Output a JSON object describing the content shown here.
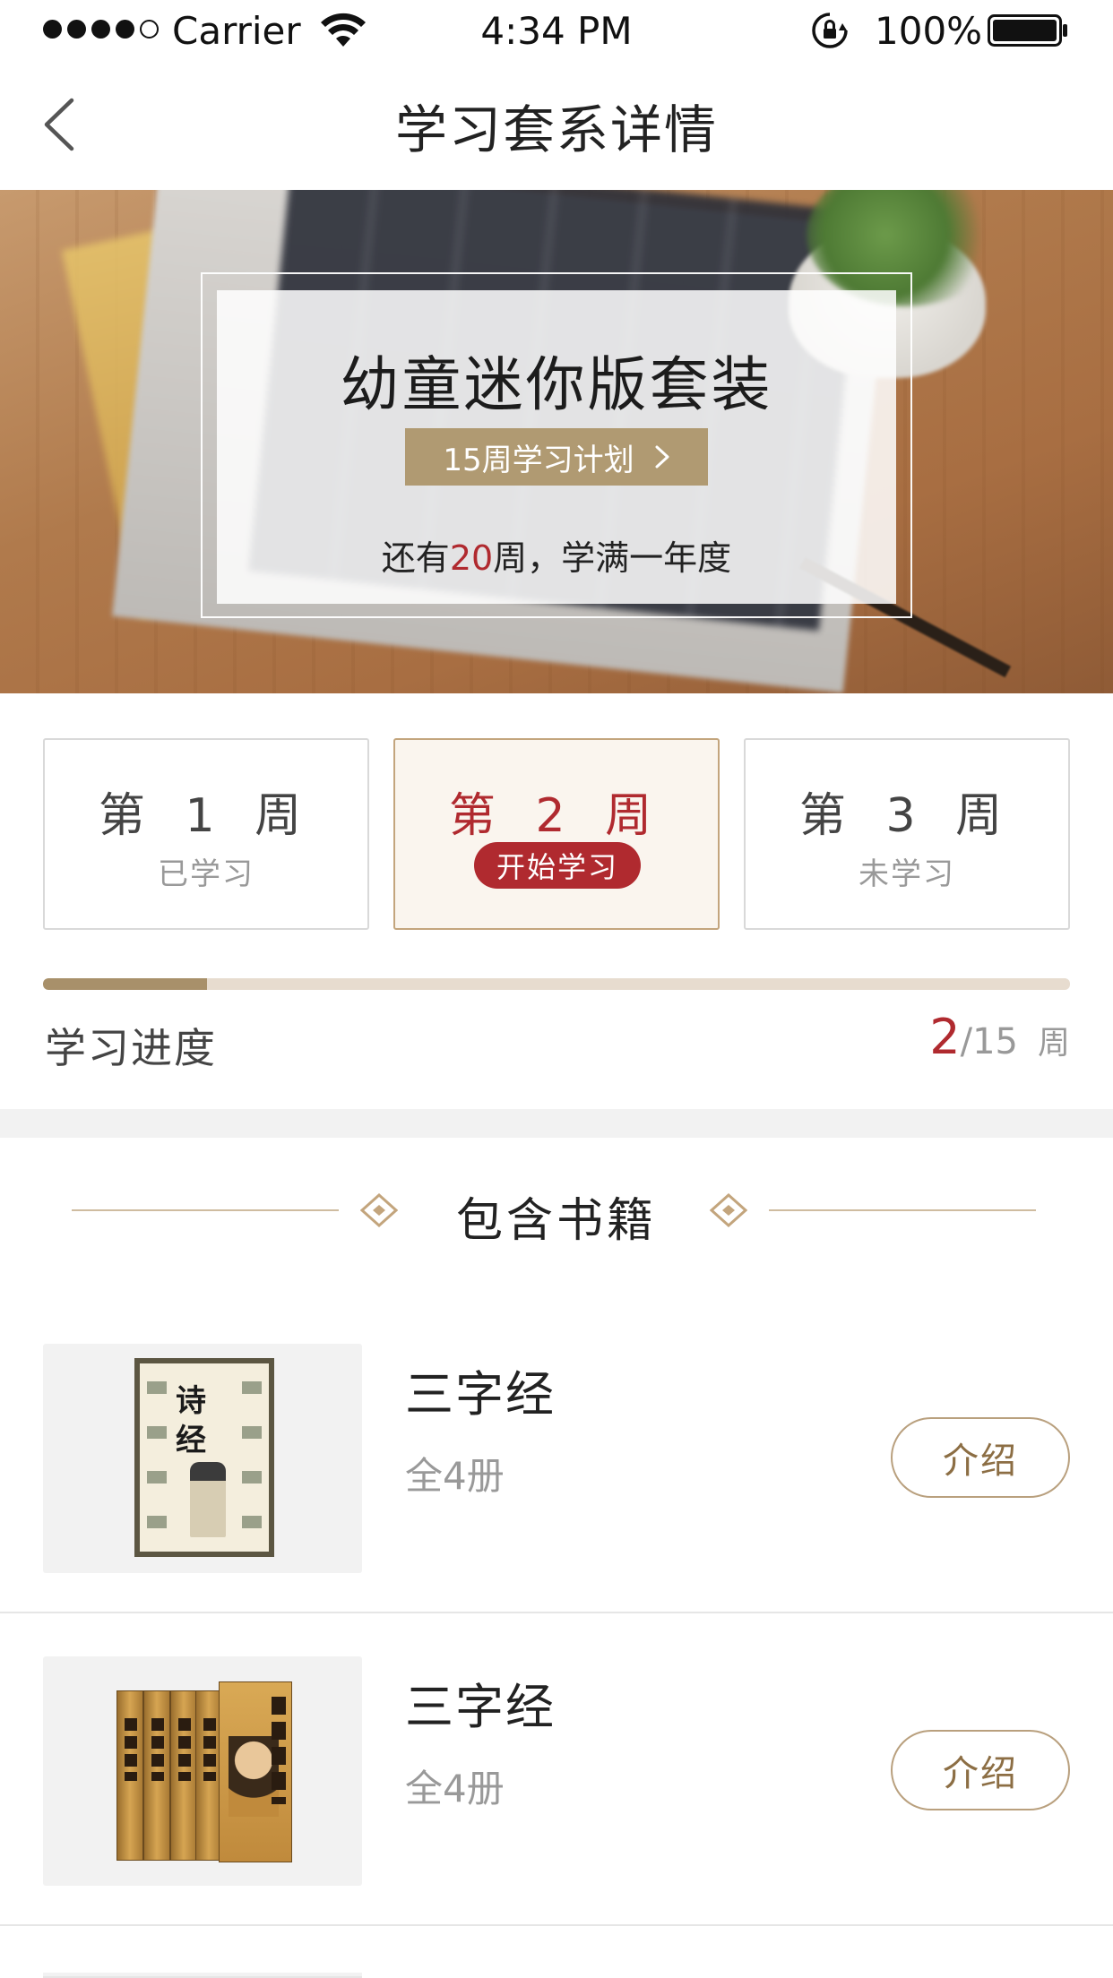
{
  "status_bar": {
    "carrier": "Carrier",
    "time": "4:34 PM",
    "battery": "100%",
    "signal_bars": 4,
    "icons": [
      "wifi-icon",
      "rotation-lock-icon",
      "battery-icon"
    ]
  },
  "nav": {
    "title": "学习套系详情",
    "back_icon": "chevron-left-icon"
  },
  "hero": {
    "title": "幼童迷你版套装",
    "plan_label": "15周学习计划",
    "remain_prefix": "还有",
    "remain_num": "20",
    "remain_suffix": "周，学满一年度"
  },
  "weeks": [
    {
      "title": "第 1 周",
      "status": "已学习"
    },
    {
      "title": "第 2 周",
      "status": "开始学习"
    },
    {
      "title": "第 3 周",
      "status": "未学习"
    }
  ],
  "progress": {
    "label": "学习进度",
    "current": "2",
    "total": "/15",
    "unit": "周",
    "fraction": 0.16
  },
  "books_section": {
    "title": "包含书籍",
    "items": [
      {
        "name": "三字经",
        "volumes": "全4册",
        "action": "介绍",
        "cover_text_1": "诗",
        "cover_text_2": "经"
      },
      {
        "name": "三字经",
        "volumes": "全4册",
        "action": "介绍"
      }
    ]
  },
  "colors": {
    "accent_red": "#b02a2f",
    "accent_gold": "#b09a72",
    "progress_track": "#e7dccf",
    "progress_fill": "#a8906a"
  }
}
